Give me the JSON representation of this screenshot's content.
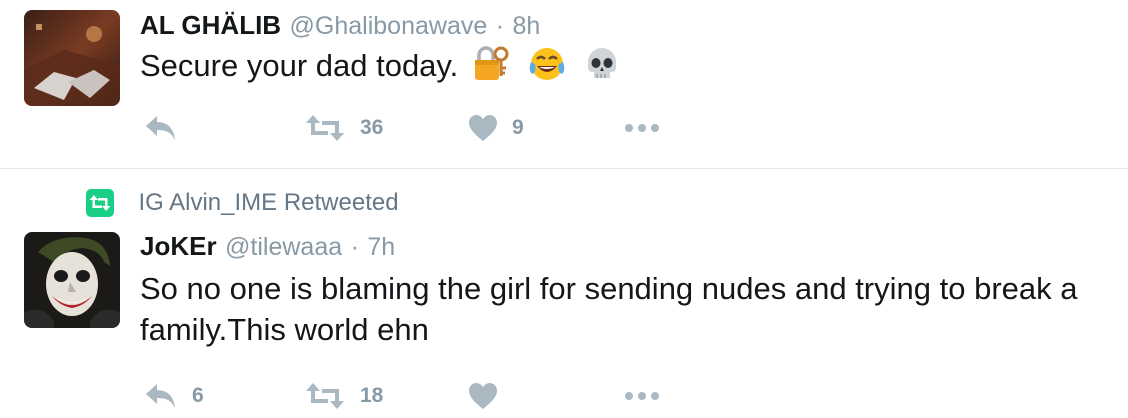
{
  "tweets": [
    {
      "name": "AL GHÄLIB",
      "handle": "@Ghalibonawave",
      "dot": "·",
      "time": "8h",
      "text": "Secure your dad today.",
      "emojis": [
        "lock-with-key-icon",
        "tears-of-joy-icon",
        "skull-icon"
      ],
      "counts": {
        "reply": "",
        "retweet": "36",
        "like": "9"
      }
    },
    {
      "retweeted_by": "IG Alvin_IME Retweeted",
      "name": "JoKEr",
      "handle": "@tilewaaa",
      "dot": "·",
      "time": "7h",
      "text_lines": [
        "So no one is blaming the girl for sending nudes and trying to break a",
        "family.This world ehn"
      ],
      "counts": {
        "reply": "6",
        "retweet": "18",
        "like": ""
      }
    }
  ],
  "colors": {
    "text": "#14171a",
    "muted": "#8899a6",
    "retweet_green": "#19cf86",
    "divider": "#e1e8ed",
    "icon_gray": "#aab8c2"
  }
}
